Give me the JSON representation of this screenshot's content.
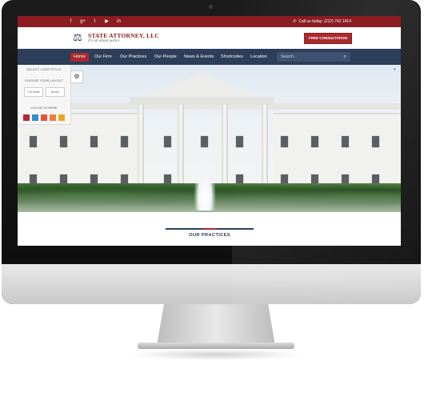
{
  "topbar": {
    "social_icons": [
      {
        "name": "facebook-icon",
        "glyph": "f"
      },
      {
        "name": "googleplus-icon",
        "glyph": "g+"
      },
      {
        "name": "twitter-icon",
        "glyph": "t"
      },
      {
        "name": "youtube-icon",
        "glyph": "▶"
      },
      {
        "name": "linkedin-icon",
        "glyph": "in"
      }
    ],
    "call_text": "Call us today: (212) 742 1414"
  },
  "header": {
    "logo_title": "STATE ATTORNEY, LLC",
    "logo_tagline": "It's all about justice",
    "consult_label": "FREE CONSULTATION"
  },
  "nav": {
    "items": [
      "Home",
      "Our Firm",
      "Our Practices",
      "Our People",
      "News & Events",
      "Shortcodes",
      "Location"
    ],
    "active_index": 0,
    "search_placeholder": "Search..."
  },
  "style_panel": {
    "select_style": "SELECT YOUR STYLE",
    "choose_layout": "CHOOSE YOUR LAYOUT",
    "layout_options": [
      "Full Width",
      "Boxed"
    ],
    "color_scheme": "COLOR SCHEME",
    "swatches": [
      "#b8262c",
      "#2f8fd1",
      "#e8553a",
      "#f17a3d",
      "#e9a824"
    ]
  },
  "section": {
    "practices_title": "OUR PRACTICES"
  },
  "colors": {
    "brand_red": "#8b1d22",
    "navy": "#2c3e59",
    "accent_red": "#a82a2f"
  }
}
